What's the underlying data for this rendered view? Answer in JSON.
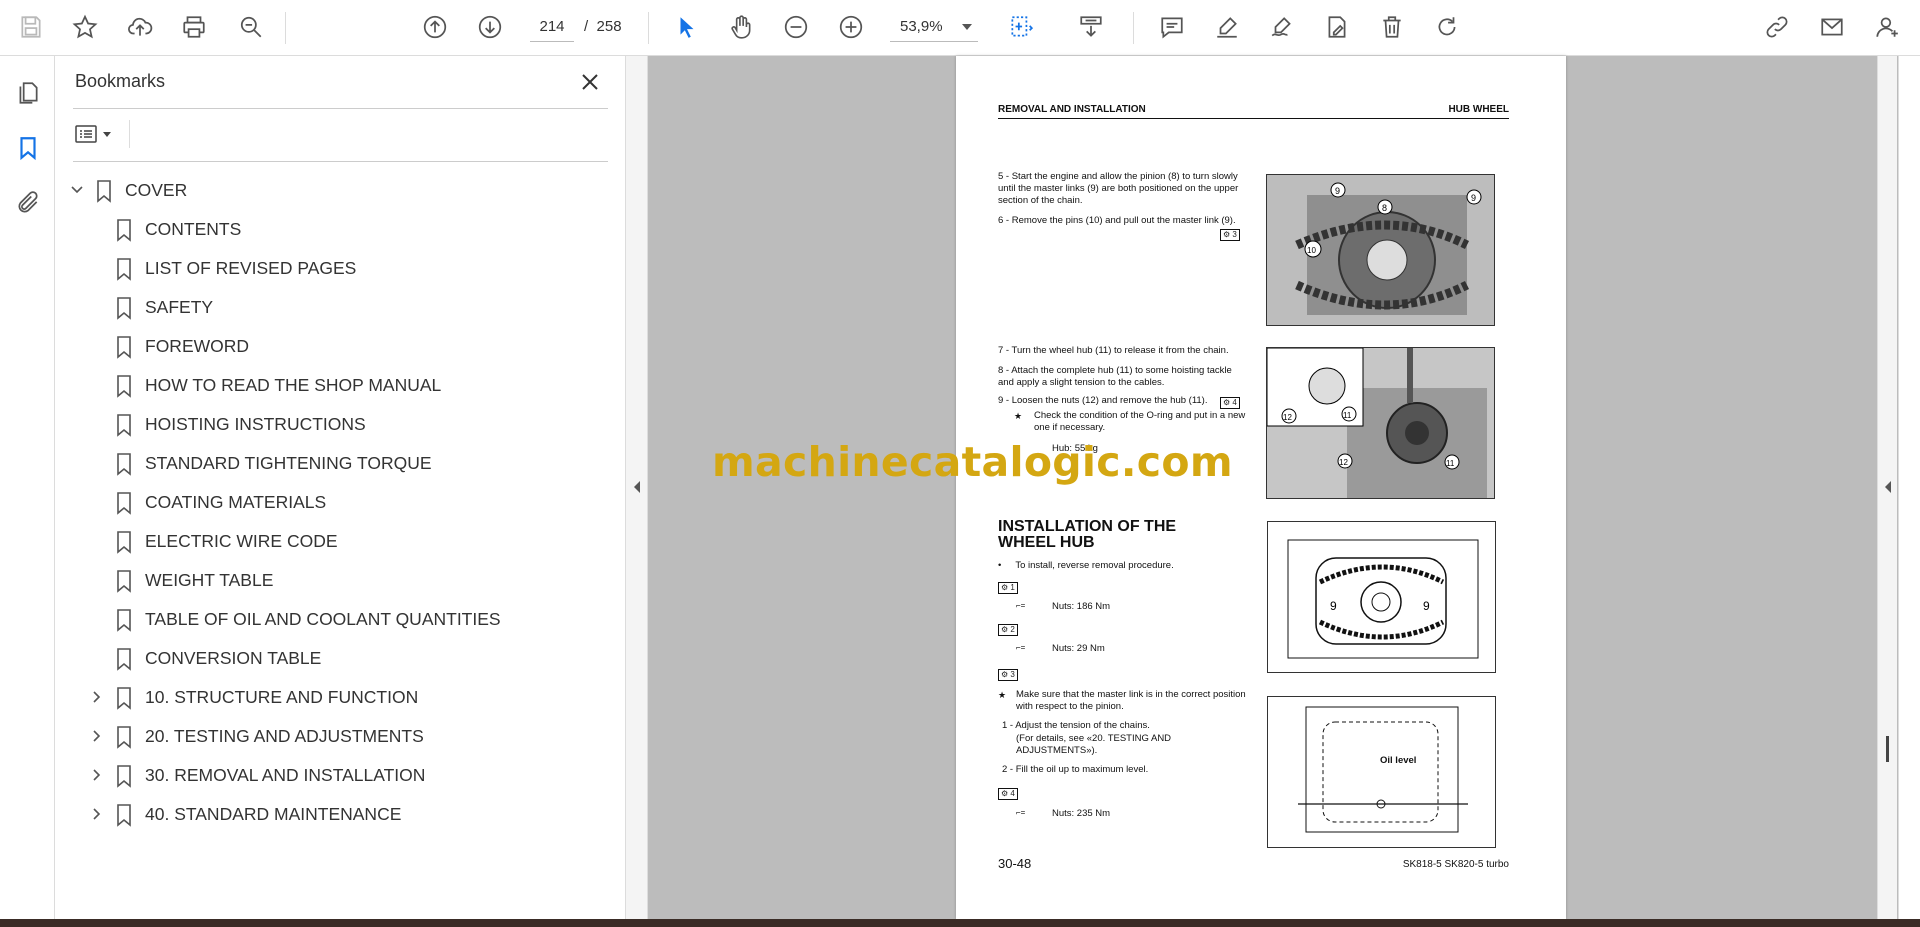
{
  "toolbar": {
    "current_page": "214",
    "page_separator": "/",
    "total_pages": "258",
    "zoom": "53,9%"
  },
  "bookmarks_panel": {
    "title": "Bookmarks",
    "items": [
      {
        "label": "COVER",
        "level": 0,
        "expander": "expanded"
      },
      {
        "label": "CONTENTS",
        "level": 1,
        "expander": "none"
      },
      {
        "label": "LIST OF REVISED PAGES",
        "level": 1,
        "expander": "none"
      },
      {
        "label": "SAFETY",
        "level": 1,
        "expander": "none"
      },
      {
        "label": "FOREWORD",
        "level": 1,
        "expander": "none"
      },
      {
        "label": "HOW TO READ THE SHOP MANUAL",
        "level": 1,
        "expander": "none"
      },
      {
        "label": "HOISTING INSTRUCTIONS",
        "level": 1,
        "expander": "none"
      },
      {
        "label": "STANDARD TIGHTENING TORQUE",
        "level": 1,
        "expander": "none"
      },
      {
        "label": "COATING MATERIALS",
        "level": 1,
        "expander": "none"
      },
      {
        "label": "ELECTRIC WIRE CODE",
        "level": 1,
        "expander": "none"
      },
      {
        "label": "WEIGHT TABLE",
        "level": 1,
        "expander": "none"
      },
      {
        "label": "TABLE OF OIL AND COOLANT QUANTITIES",
        "level": 1,
        "expander": "none"
      },
      {
        "label": "CONVERSION TABLE",
        "level": 1,
        "expander": "none"
      },
      {
        "label": "10. STRUCTURE AND FUNCTION",
        "level": 1,
        "expander": "collapsed"
      },
      {
        "label": "20. TESTING AND ADJUSTMENTS",
        "level": 1,
        "expander": "collapsed"
      },
      {
        "label": "30. REMOVAL AND INSTALLATION",
        "level": 1,
        "expander": "collapsed"
      },
      {
        "label": "40. STANDARD MAINTENANCE",
        "level": 1,
        "expander": "collapsed"
      }
    ]
  },
  "document": {
    "header_left": "REMOVAL AND INSTALLATION",
    "header_right": "HUB WHEEL",
    "step5": "5 - Start the engine and allow the pinion (8) to turn slowly until the master links (9) are both positioned on the upper section of the chain.",
    "step6": "6 - Remove the pins (10) and pull out the master link (9).",
    "step7": "7 - Turn the wheel hub (11) to release it from the chain.",
    "step8": "8 - Attach the complete hub (11) to some hoisting tackle and apply a slight tension to the cables.",
    "step9": "9 - Loosen the nuts (12) and remove the hub (11).",
    "note9": "Check the condition of the O-ring and put in a new one if necessary.",
    "hub_weight": "Hub: 55 kg",
    "section_title": "INSTALLATION OF THE WHEEL HUB",
    "install_bullet": "To install, reverse removal procedure.",
    "tag1": "1",
    "spec1": "Nuts: 186 Nm",
    "tag2": "2",
    "spec2": "Nuts: 29 Nm",
    "tag3": "3",
    "note3": "Make sure that the master link is in the correct position with respect to the pinion.",
    "adj1": "1 - Adjust the tension of the chains.",
    "adj1b": "(For details, see «20. TESTING AND ADJUSTMENTS»).",
    "adj2": "2 - Fill the oil up to maximum level.",
    "tag4": "4",
    "spec4": "Nuts: 235 Nm",
    "fig3_label": "Oil level",
    "page_number": "30-48",
    "model": "SK818-5   SK820-5 turbo"
  },
  "watermark": "machinecatalogic.com",
  "icons": [
    "save-icon",
    "star-icon",
    "upload-icon",
    "print-icon",
    "zoom-search-icon",
    "prev-page-icon",
    "next-page-icon",
    "zoom-out-icon",
    "zoom-in-icon",
    "select-icon",
    "hand-icon",
    "marquee-zoom-icon",
    "scroll-icon",
    "comment-icon",
    "highlight-icon",
    "sign-icon",
    "edit-icon",
    "delete-icon",
    "rotate-icon",
    "link-icon",
    "mail-icon",
    "account-icon",
    "pages-icon",
    "bookmark-icon",
    "paperclip-icon"
  ]
}
